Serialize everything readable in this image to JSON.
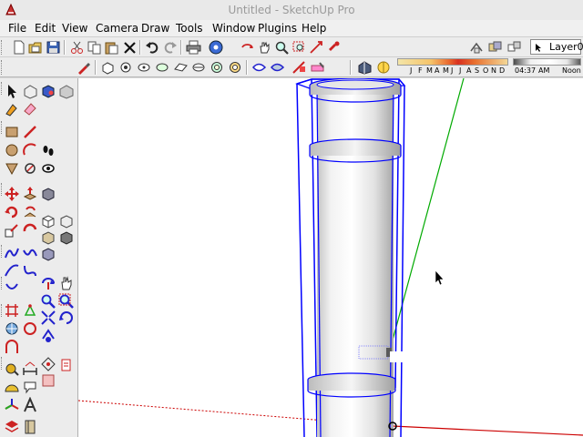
{
  "window": {
    "title": "Untitled - SketchUp Pro"
  },
  "menubar": {
    "items": [
      "File",
      "Edit",
      "View",
      "Camera",
      "Draw",
      "Tools",
      "Window",
      "Plugins",
      "Help"
    ]
  },
  "toolbar1": {
    "icons": [
      "new-file-icon",
      "open-file-icon",
      "save-icon",
      "cut-icon",
      "copy-icon",
      "paste-icon",
      "erase-icon",
      "undo-icon",
      "redo-icon",
      "print-icon",
      "model-info-icon",
      "orbit-tool-icon",
      "pan-tool-icon",
      "zoom-tool-icon",
      "zoom-window-icon",
      "zoom-extents-icon",
      "previous-view-icon",
      "follow-me-icon",
      "intersect-icon"
    ],
    "layer": {
      "name": "Layer0"
    }
  },
  "toolbar2": {
    "icons": [
      "paint-icon",
      "iso-view-icon",
      "top-view-icon",
      "front-view-icon",
      "right-view-icon",
      "back-view-icon",
      "left-view-icon",
      "xray-icon",
      "wireframe-icon",
      "hidden-line-icon",
      "shaded-icon",
      "shaded-textures-icon",
      "monochrome-icon",
      "section-plane-icon",
      "section-display-icon"
    ],
    "shadows": {
      "months": [
        "J",
        "F",
        "M",
        "A",
        "M",
        "J",
        "J",
        "A",
        "S",
        "O",
        "N",
        "D"
      ],
      "time_start": "04:37",
      "time_mid": "AM",
      "time_end": "Noon"
    }
  },
  "lefttoolbar": {
    "tools": [
      "select-icon",
      "make-component-icon",
      "paint-bucket-icon",
      "eraser-icon",
      "rectangle-icon",
      "line-icon",
      "circle-icon",
      "arc-icon",
      "polygon-icon",
      "freehand-icon",
      "move-icon",
      "push-pull-icon",
      "rotate-icon",
      "follow-me-icon",
      "scale-icon",
      "offset-icon",
      "tape-measure-icon",
      "dimension-icon",
      "protractor-icon",
      "text-icon",
      "axes-icon",
      "3d-text-icon",
      "orbit-icon",
      "pan-icon",
      "zoom-icon",
      "zoom-window-icon",
      "zoom-extents-icon",
      "walk-icon",
      "look-around-icon",
      "position-camera-icon",
      "section-plane-icon",
      "sandbox-icon"
    ]
  },
  "colors": {
    "selection": "#0000ff",
    "green_axis": "#00aa00",
    "red_axis": "#cc0000"
  }
}
